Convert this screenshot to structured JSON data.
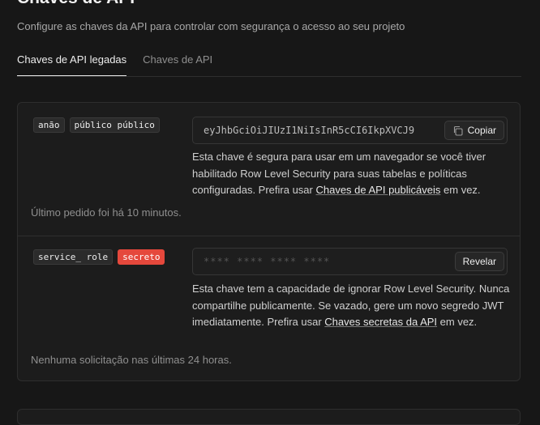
{
  "page": {
    "title": "Chaves de API",
    "subtitle": "Configure as chaves da API para controlar com segurança o acesso ao seu projeto"
  },
  "tabs": [
    {
      "label": "Chaves de API legadas",
      "active": true
    },
    {
      "label": "Chaves de API",
      "active": false
    }
  ],
  "keys": [
    {
      "badges": [
        "anão",
        "público público"
      ],
      "value": "eyJhbGciOiJIUzI1NiIsInR5cCI6IkpXVCJ9",
      "button_label": "Copiar",
      "button_icon": "copy-icon",
      "desc_before": "Esta chave é segura para usar em um navegador se você tiver habilitado Row Level Security para suas tabelas e políticas configuradas. Prefira usar ",
      "desc_link": "Chaves de API publicáveis",
      "desc_after": " em vez.",
      "status": "Último pedido foi há 10 minutos."
    },
    {
      "badges": [
        "service_ role",
        "secreto"
      ],
      "value": "**** **** **** ****",
      "button_label": "Revelar",
      "desc_before": "Esta chave tem a capacidade de ignorar Row Level Security. Nunca compartilhe publicamente. Se vazado, gere um novo segredo JWT imediatamente. Prefira usar ",
      "desc_link": "Chaves secretas da API",
      "desc_after": " em vez.",
      "status": "Nenhuma solicitação nas últimas 24 horas."
    }
  ],
  "colors": {
    "background": "#171717",
    "card": "#1c1c1c",
    "secret_badge": "#e5483c"
  }
}
